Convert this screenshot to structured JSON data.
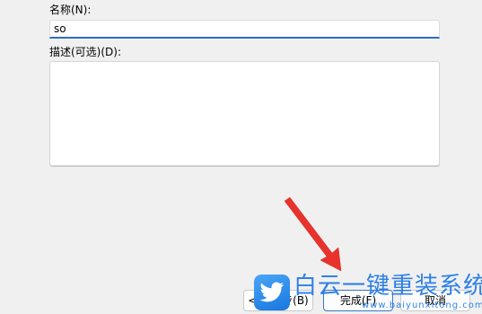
{
  "form": {
    "name_label": "名称(N):",
    "name_value": "so",
    "description_label": "描述(可选)(D):",
    "description_value": ""
  },
  "buttons": {
    "back_label": "< 上一步(B)",
    "finish_label": "完成(F)",
    "cancel_label": "取消"
  },
  "watermark": {
    "title": "白云一键重装系统",
    "url": "www.baiyunxitong.com"
  },
  "colors": {
    "arrow": "#e8322c",
    "focus_accent": "#2b6fbf",
    "watermark": "#1e78e6"
  },
  "icons": {
    "watermark_logo": "twitter-bird-icon",
    "annotation": "red-arrow-icon"
  }
}
